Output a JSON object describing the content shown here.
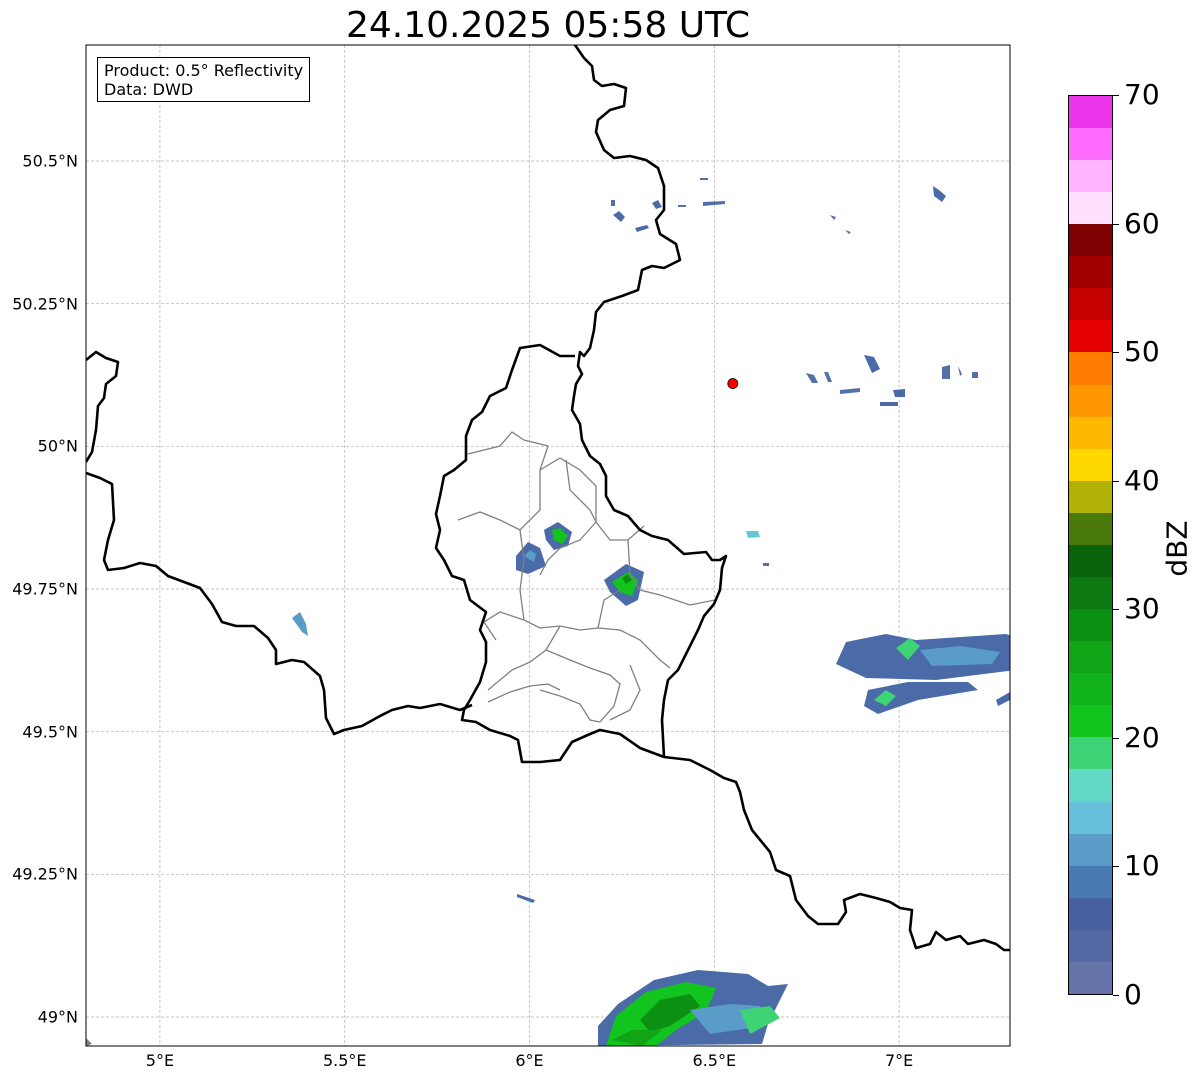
{
  "title": "24.10.2025 05:58 UTC",
  "info": {
    "product": "Product: 0.5° Reflectivity",
    "data": "Data: DWD"
  },
  "lat_ticks": [
    {
      "value": 50.5,
      "label": "50.5°N"
    },
    {
      "value": 50.25,
      "label": "50.25°N"
    },
    {
      "value": 50.0,
      "label": "50°N"
    },
    {
      "value": 49.75,
      "label": "49.75°N"
    },
    {
      "value": 49.5,
      "label": "49.5°N"
    },
    {
      "value": 49.25,
      "label": "49.25°N"
    },
    {
      "value": 49.0,
      "label": "49°N"
    }
  ],
  "lon_ticks": [
    {
      "value": 5.0,
      "label": "5°E"
    },
    {
      "value": 5.5,
      "label": "5.5°E"
    },
    {
      "value": 6.0,
      "label": "6°E"
    },
    {
      "value": 6.5,
      "label": "6.5°E"
    },
    {
      "value": 7.0,
      "label": "7°E"
    }
  ],
  "map_extent": {
    "lon_min": 4.8,
    "lon_max": 7.3,
    "lat_min": 48.95,
    "lat_max": 50.7
  },
  "radar_site": {
    "lon": 6.55,
    "lat": 50.11,
    "color": "#ff0000"
  },
  "colorbar": {
    "label": "dBZ",
    "min": 0,
    "max": 70,
    "ticks": [
      "0",
      "10",
      "20",
      "30",
      "40",
      "50",
      "60",
      "70"
    ],
    "colors": [
      "#6474a8",
      "#5468a4",
      "#4660a2",
      "#4a7ab4",
      "#5a9cc8",
      "#66c0dc",
      "#62d8c6",
      "#3ed476",
      "#12c41e",
      "#10b41a",
      "#10a416",
      "#0c9012",
      "#0c7a10",
      "#0a640c",
      "#4a7a0a",
      "#b0b208",
      "#ffd800",
      "#ffb800",
      "#ff9800",
      "#ff7c00",
      "#e40000",
      "#c40000",
      "#a20000",
      "#7e0000",
      "#ffe0ff",
      "#ffb4ff",
      "#ff6cff",
      "#ec36ec"
    ]
  }
}
